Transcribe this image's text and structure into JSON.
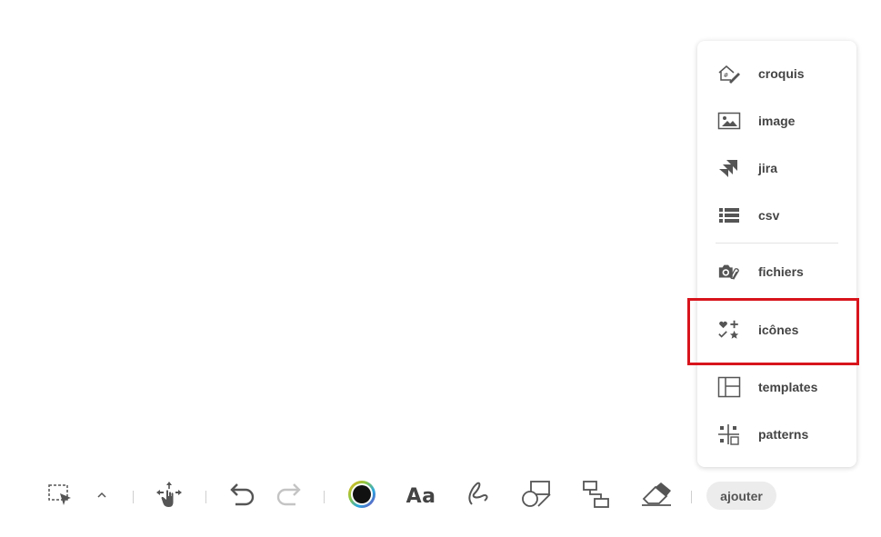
{
  "menu": {
    "items": [
      {
        "label": "croquis",
        "icon": "sketch-house-icon"
      },
      {
        "label": "image",
        "icon": "image-icon"
      },
      {
        "label": "jira",
        "icon": "jira-icon"
      },
      {
        "label": "csv",
        "icon": "list-icon"
      },
      {
        "label": "fichiers",
        "icon": "camera-paperclip-icon"
      },
      {
        "label": "icônes",
        "icon": "icons-grid-icon"
      },
      {
        "label": "templates",
        "icon": "template-layout-icon"
      },
      {
        "label": "patterns",
        "icon": "patterns-icon"
      }
    ],
    "highlighted_item": "icônes",
    "highlight_color": "#d8141c"
  },
  "toolbar": {
    "text_tool_label": "Aa",
    "add_button_label": "ajouter",
    "color_swatch": "#111111"
  }
}
